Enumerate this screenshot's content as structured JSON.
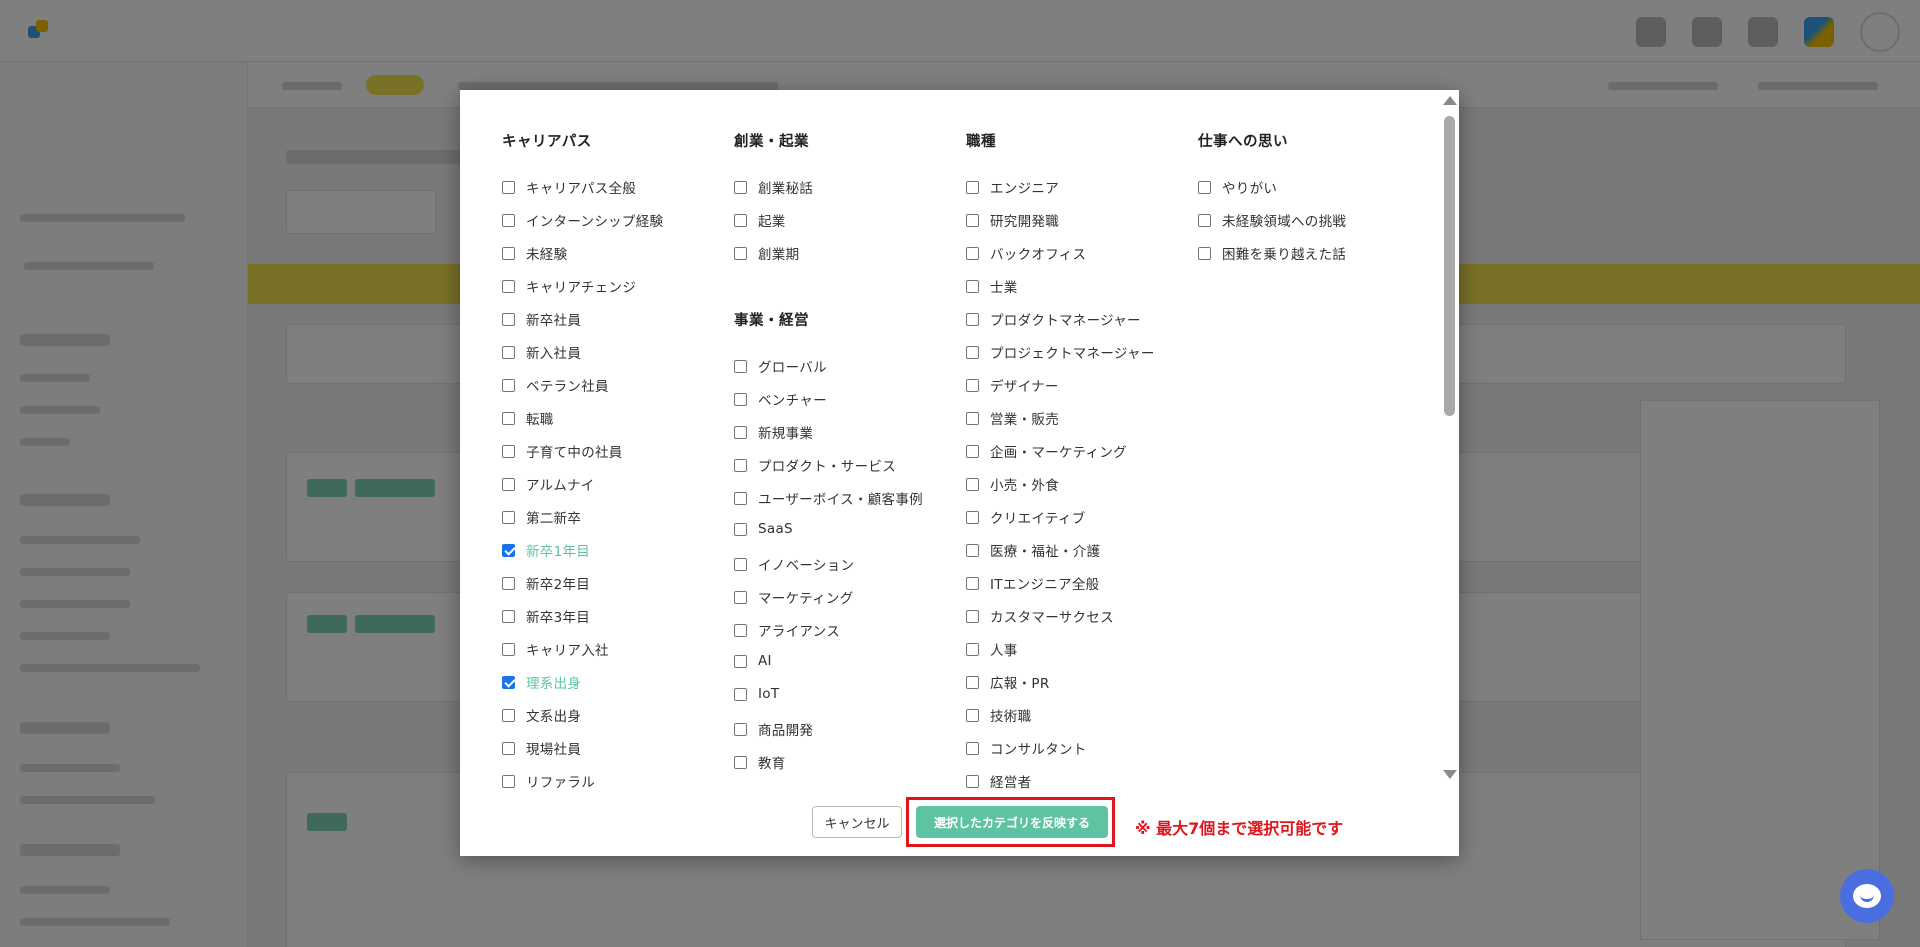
{
  "modal": {
    "columns": [
      {
        "groups": [
          {
            "title": "キャリアパス",
            "options": [
              {
                "label": "キャリアパス全般",
                "checked": false
              },
              {
                "label": "インターンシップ経験",
                "checked": false
              },
              {
                "label": "未経験",
                "checked": false
              },
              {
                "label": "キャリアチェンジ",
                "checked": false
              },
              {
                "label": "新卒社員",
                "checked": false
              },
              {
                "label": "新入社員",
                "checked": false
              },
              {
                "label": "ベテラン社員",
                "checked": false
              },
              {
                "label": "転職",
                "checked": false
              },
              {
                "label": "子育て中の社員",
                "checked": false
              },
              {
                "label": "アルムナイ",
                "checked": false
              },
              {
                "label": "第二新卒",
                "checked": false
              },
              {
                "label": "新卒1年目",
                "checked": true
              },
              {
                "label": "新卒2年目",
                "checked": false
              },
              {
                "label": "新卒3年目",
                "checked": false
              },
              {
                "label": "キャリア入社",
                "checked": false
              },
              {
                "label": "理系出身",
                "checked": true
              },
              {
                "label": "文系出身",
                "checked": false
              },
              {
                "label": "現場社員",
                "checked": false
              },
              {
                "label": "リファラル",
                "checked": false
              }
            ]
          }
        ]
      },
      {
        "groups": [
          {
            "title": "創業・起業",
            "options": [
              {
                "label": "創業秘話",
                "checked": false
              },
              {
                "label": "起業",
                "checked": false
              },
              {
                "label": "創業期",
                "checked": false
              }
            ]
          },
          {
            "title": "事業・経営",
            "options": [
              {
                "label": "グローバル",
                "checked": false
              },
              {
                "label": "ベンチャー",
                "checked": false
              },
              {
                "label": "新規事業",
                "checked": false
              },
              {
                "label": "プロダクト・サービス",
                "checked": false
              },
              {
                "label": "ユーザーボイス・顧客事例",
                "checked": false
              },
              {
                "label": "SaaS",
                "checked": false
              },
              {
                "label": "イノベーション",
                "checked": false
              },
              {
                "label": "マーケティング",
                "checked": false
              },
              {
                "label": "アライアンス",
                "checked": false
              },
              {
                "label": "AI",
                "checked": false
              },
              {
                "label": "IoT",
                "checked": false
              },
              {
                "label": "商品開発",
                "checked": false
              },
              {
                "label": "教育",
                "checked": false
              }
            ]
          }
        ]
      },
      {
        "groups": [
          {
            "title": "職種",
            "options": [
              {
                "label": "エンジニア",
                "checked": false
              },
              {
                "label": "研究開発職",
                "checked": false
              },
              {
                "label": "バックオフィス",
                "checked": false
              },
              {
                "label": "士業",
                "checked": false
              },
              {
                "label": "プロダクトマネージャー",
                "checked": false
              },
              {
                "label": "プロジェクトマネージャー",
                "checked": false
              },
              {
                "label": "デザイナー",
                "checked": false
              },
              {
                "label": "営業・販売",
                "checked": false
              },
              {
                "label": "企画・マーケティング",
                "checked": false
              },
              {
                "label": "小売・外食",
                "checked": false
              },
              {
                "label": "クリエイティブ",
                "checked": false
              },
              {
                "label": "医療・福祉・介護",
                "checked": false
              },
              {
                "label": "ITエンジニア全般",
                "checked": false
              },
              {
                "label": "カスタマーサクセス",
                "checked": false
              },
              {
                "label": "人事",
                "checked": false
              },
              {
                "label": "広報・PR",
                "checked": false
              },
              {
                "label": "技術職",
                "checked": false
              },
              {
                "label": "コンサルタント",
                "checked": false
              },
              {
                "label": "経営者",
                "checked": false
              }
            ]
          }
        ]
      },
      {
        "groups": [
          {
            "title": "仕事への思い",
            "options": [
              {
                "label": "やりがい",
                "checked": false
              },
              {
                "label": "未経験領域への挑戦",
                "checked": false
              },
              {
                "label": "困難を乗り越えた話",
                "checked": false
              }
            ]
          }
        ]
      }
    ],
    "cancel_label": "キャンセル",
    "apply_label": "選択したカテゴリを反映する",
    "limit_note": "※ 最大7個まで選択可能です"
  },
  "colors": {
    "accent_green": "#5fc3a3",
    "checkbox_blue": "#1a73e8",
    "alert_red": "#e0161d",
    "chat_blue": "#4a6ee0"
  }
}
